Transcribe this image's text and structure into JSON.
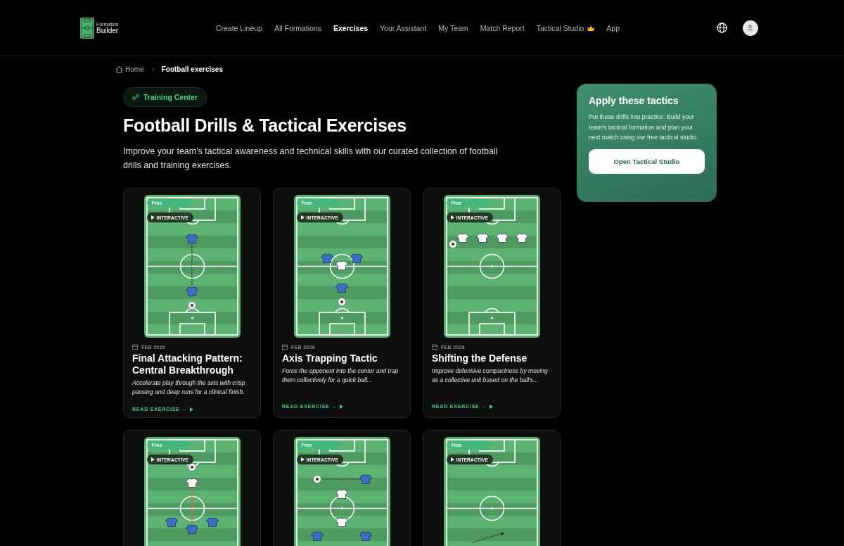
{
  "logo": {
    "small": "Formation",
    "large": "Builder"
  },
  "nav": [
    {
      "label": "Create Lineup",
      "selected": false
    },
    {
      "label": "All Formations",
      "selected": false
    },
    {
      "label": "Exercises",
      "selected": true
    },
    {
      "label": "Your Assistant",
      "selected": false
    },
    {
      "label": "My Team",
      "selected": false
    },
    {
      "label": "Match Report",
      "selected": false
    },
    {
      "label": "Tactical Studio",
      "selected": false,
      "premium": true
    },
    {
      "label": "App",
      "selected": false
    }
  ],
  "breadcrumb": [
    {
      "label": "Home",
      "kind": "home"
    },
    {
      "label": "Football exercises",
      "kind": "current"
    }
  ],
  "hero": {
    "badge": "Training Center",
    "title": "Football Drills & Tactical Exercises",
    "subtitle": "Improve your team's tactical awareness and technical skills with our curated collection of football drills and training exercises."
  },
  "cards": [
    {
      "badge": "Free",
      "interactive": "INTERACTIVE",
      "date": "FEB 2026",
      "title": "Final Attacking Pattern: Central Breakthrough",
      "description": "Accelerate play through the axis with crisp passing and deep runs for a clinical finish.",
      "link": "READ EXERCISE →"
    },
    {
      "badge": "Free",
      "interactive": "INTERACTIVE",
      "date": "FEB 2026",
      "title": "Axis Trapping Tactic",
      "description": "Force the opponent into the center and trap them collectively for a quick ball...",
      "link": "READ EXERCISE →"
    },
    {
      "badge": "Free",
      "interactive": "INTERACTIVE",
      "date": "FEB 2026",
      "title": "Shifting the Defense",
      "description": "Improve defensive compactness by moving as a collective unit based on the ball's...",
      "link": "READ EXERCISE →"
    },
    {
      "badge": "Free",
      "interactive": "INTERACTIVE"
    },
    {
      "badge": "Free",
      "interactive": "INTERACTIVE"
    },
    {
      "badge": "Free",
      "interactive": "INTERACTIVE"
    }
  ],
  "cta": {
    "title": "Apply these tactics",
    "text": "Put these drills into practice. Build your team's tactical formation and plan your next match using our free tactical studio.",
    "button": "Open Tactical Studio"
  }
}
